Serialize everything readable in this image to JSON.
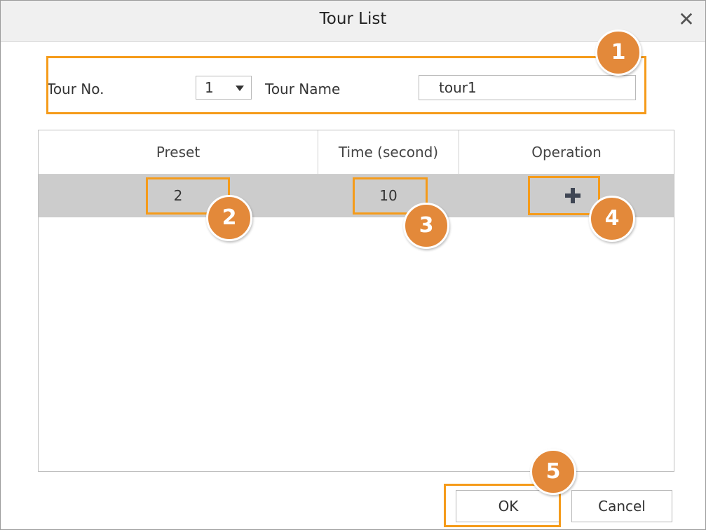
{
  "dialog": {
    "title": "Tour List",
    "close_icon": "close-icon"
  },
  "form": {
    "tour_no_label": "Tour No.",
    "tour_no_value": "1",
    "tour_name_label": "Tour Name",
    "tour_name_value": "tour1"
  },
  "table": {
    "columns": [
      "Preset",
      "Time (second)",
      "Operation"
    ],
    "rows": [
      {
        "preset": "2",
        "time": "10",
        "operation_icon": "plus-icon"
      }
    ]
  },
  "buttons": {
    "ok": "OK",
    "cancel": "Cancel"
  },
  "callouts": [
    "1",
    "2",
    "3",
    "4",
    "5"
  ],
  "colors": {
    "highlight": "#f59b1a",
    "badge": "#e3893a",
    "selected_row": "#cccccc"
  }
}
